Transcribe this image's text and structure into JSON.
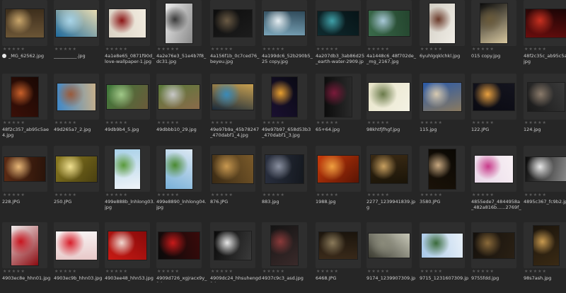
{
  "browser": {
    "rating_glyph": "★★★★★",
    "rows": [
      {
        "items": [
          {
            "name": "_MG_62562.jpg",
            "selected": true,
            "palette": [
              "#6b5536",
              "#c9a66b",
              "#3d2e1c"
            ]
          },
          {
            "name": "__________.jpg",
            "palette": [
              "#1f6a9c",
              "#a8d4e8",
              "#e8dcb2"
            ]
          },
          {
            "name": "4a1e8e65_0871f90d_love-wallpaper-1.jpg",
            "palette": [
              "#d9d2c4",
              "#8b1414",
              "#f2ece0"
            ]
          },
          {
            "name": "4a2e76e3_51e4b7f8_dc31.jpg",
            "palette": [
              "#ececec",
              "#3a3a3a",
              "#8a8a8a"
            ]
          },
          {
            "name": "4a156f1b_0c7ced76_beyeu.jpg",
            "palette": [
              "#0d0d0d",
              "#6a5a44",
              "#1c1c1c"
            ]
          },
          {
            "name": "4a199dc6_52b290b5_25 copy.jpg",
            "palette": [
              "#7aa4b8",
              "#e6eef2",
              "#2f4a5a"
            ]
          },
          {
            "name": "4a207db3_3ab86d25_earth-water-2909.jpg",
            "palette": [
              "#0f2a2e",
              "#3fa0a8",
              "#071417"
            ]
          },
          {
            "name": "4a1448c6_48f702de__mg_2167.jpg",
            "palette": [
              "#3a6a4a",
              "#a8c8d8",
              "#24452e"
            ]
          },
          {
            "name": "6yuhlgqklchkl.jpg",
            "palette": [
              "#d2cec4",
              "#6b3a2a",
              "#f0ede6"
            ]
          },
          {
            "name": "015 copy.jpg",
            "palette": [
              "#0b0b0b",
              "#6a5a3a",
              "#d8c8a0"
            ]
          },
          {
            "name": "48f2c35c_ab95c5ae5.jpg",
            "palette": [
              "#6a0d0d",
              "#c83020",
              "#1a0505"
            ]
          }
        ]
      },
      {
        "items": [
          {
            "name": "48f2c357_ab95c5ae4.jpg",
            "palette": [
              "#3a1008",
              "#c8602a",
              "#1a0804"
            ]
          },
          {
            "name": "49d265a7_2.jpg",
            "palette": [
              "#3f88c8",
              "#9a5a3a",
              "#c8b08a"
            ]
          },
          {
            "name": "49db9b4_5.jpg",
            "palette": [
              "#3e7a3a",
              "#a0c888",
              "#6a5a3a"
            ]
          },
          {
            "name": "49dbbb10_29.jpg",
            "palette": [
              "#5a7a3a",
              "#c8c8c8",
              "#8a6a4a"
            ]
          },
          {
            "name": "49e97b9a_45b78247_470dabf1_4.jpg",
            "palette": [
              "#1a2a3a",
              "#3a8ab8",
              "#c8a050"
            ]
          },
          {
            "name": "49e97b97_658d53b3_470dabf1_3.jpg",
            "palette": [
              "#1a1030",
              "#e8a030",
              "#0a0a14"
            ]
          },
          {
            "name": "65+64.jpg",
            "palette": [
              "#0c0c0c",
              "#7a1a3a",
              "#2a2a2a"
            ]
          },
          {
            "name": "98khtfjfhgf.jpg",
            "palette": [
              "#e8e4c8",
              "#6a7a4a",
              "#f4f2e4"
            ]
          },
          {
            "name": "115.jpg",
            "palette": [
              "#2a5aa8",
              "#d8cab0",
              "#8a7a60"
            ]
          },
          {
            "name": "122.JPG",
            "palette": [
              "#0a0a12",
              "#e8a040",
              "#14141e"
            ]
          },
          {
            "name": "124.jpg",
            "palette": [
              "#1a1a1a",
              "#8a7a6a",
              "#3a3a3a"
            ]
          }
        ]
      },
      {
        "items": [
          {
            "name": "228.JPG",
            "palette": [
              "#5a2a14",
              "#e8b878",
              "#2a140a"
            ]
          },
          {
            "name": "250.JPG",
            "palette": [
              "#8a7a20",
              "#f0e090",
              "#4a4010"
            ]
          },
          {
            "name": "499e888b_lnhlong03.jpg",
            "palette": [
              "#a8d0e8",
              "#5a9a3a",
              "#f0f4f8"
            ]
          },
          {
            "name": "499e8890_lnhlong04.jpg",
            "palette": [
              "#78b0d8",
              "#4a8a30",
              "#dce8f2"
            ]
          },
          {
            "name": "876.JPG",
            "palette": [
              "#3a2a14",
              "#c89850",
              "#7a5a2a"
            ]
          },
          {
            "name": "883.jpg",
            "palette": [
              "#2a3040",
              "#8a90a0",
              "#14181e"
            ]
          },
          {
            "name": "1988.jpg",
            "palette": [
              "#c83a0a",
              "#f0a040",
              "#5a1404"
            ]
          },
          {
            "name": "2277_1239941839.jpg",
            "palette": [
              "#3a2a14",
              "#c8a060",
              "#1a1408"
            ]
          },
          {
            "name": "3580.JPG",
            "palette": [
              "#1a1208",
              "#c8a880",
              "#0a0804"
            ]
          },
          {
            "name": "4855ede7_4844958a_482a816b......2769f_3.jpg",
            "palette": [
              "#e8d8e8",
              "#c83a8a",
              "#f8f0f4"
            ]
          },
          {
            "name": "4895c367_fc9b2.jpg",
            "palette": [
              "#0a0a0a",
              "#e8e8e8",
              "#8a8a8a"
            ]
          }
        ]
      },
      {
        "items": [
          {
            "name": "4903ec8e_hhn01.jpg",
            "palette": [
              "#f0ecec",
              "#c8141e",
              "#8a0a10"
            ]
          },
          {
            "name": "4903ec9b_hhn03.jpg",
            "palette": [
              "#f8f4f4",
              "#d81e2a",
              "#e8c8c8"
            ]
          },
          {
            "name": "4903ee48_hhn53.jpg",
            "palette": [
              "#c81a14",
              "#f0d8d0",
              "#8a0a0a"
            ]
          },
          {
            "name": "4909d726_xgjracx9y_1.jpg",
            "palette": [
              "#0a0a0a",
              "#c81a1a",
              "#3a0a0a"
            ]
          },
          {
            "name": "4909dc24_hhsuhengd1.jpg",
            "palette": [
              "#0a0a0a",
              "#e8e8e8",
              "#3a3a3a"
            ]
          },
          {
            "name": "4937c9c3_asd.jpg",
            "palette": [
              "#141414",
              "#8a3a3a",
              "#3a2a2a"
            ]
          },
          {
            "name": "6468.JPG",
            "palette": [
              "#3a2a1a",
              "#8a7a5a",
              "#1a140c"
            ]
          },
          {
            "name": "9174_1239907309.jpg",
            "palette": [
              "#3a3a30",
              "#8a8a7a",
              "#c8c8b8"
            ]
          },
          {
            "name": "9715_1231607309.jpg",
            "palette": [
              "#a8c8e8",
              "#3a6a3a",
              "#e8f0f8"
            ]
          },
          {
            "name": "9755fdd.jpg",
            "palette": [
              "#14100c",
              "#8a6a3a",
              "#2a2014"
            ]
          },
          {
            "name": "98s7ash.jpg",
            "palette": [
              "#1a140c",
              "#c89a50",
              "#3a2a14"
            ]
          }
        ]
      }
    ]
  }
}
